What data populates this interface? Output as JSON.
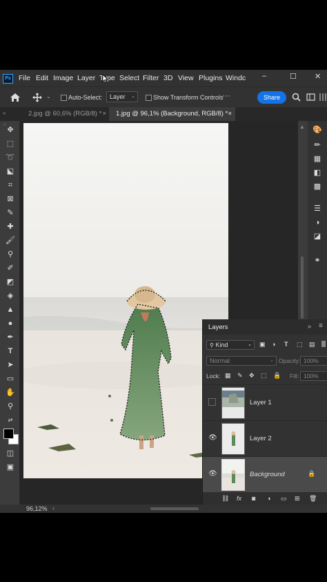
{
  "menu": {
    "logo": "Ps",
    "items": [
      "File",
      "Edit",
      "Image",
      "Layer",
      "Type",
      "Select",
      "Filter",
      "3D",
      "View",
      "Plugins",
      "Windc"
    ],
    "minimize": "–",
    "maximize": "☐",
    "close": "✕"
  },
  "options": {
    "auto_select_label": "Auto-Select:",
    "auto_select_value": "Layer",
    "transform_controls_label": "Show Transform Controls",
    "share_label": "Share"
  },
  "tabs": [
    {
      "label": "2.jpg @ 60,6% (RGB/8) *",
      "close": "×"
    },
    {
      "label": "1.jpg @ 96,1% (Background, RGB/8) *",
      "close": "×"
    }
  ],
  "layers_panel": {
    "title": "Layers",
    "filter_label": "Kind",
    "blend_mode": "Normal",
    "opacity_label": "Opacity:",
    "opacity_value": "100%",
    "lock_label": "Lock:",
    "fill_label": "Fill:",
    "fill_value": "100%",
    "layers": [
      {
        "name": "Layer 1",
        "visible": false
      },
      {
        "name": "Layer 2",
        "visible": true
      },
      {
        "name": "Background",
        "visible": true,
        "locked": true
      }
    ]
  },
  "status": {
    "zoom": "96,12%"
  },
  "colors": {
    "accent": "#1473e6",
    "panel": "#323232",
    "canvas_bg": "#262626",
    "dress": "#5e8a5a",
    "hat": "#e6cda6",
    "sand": "#ece6df",
    "sky": "#f4f4f2"
  }
}
